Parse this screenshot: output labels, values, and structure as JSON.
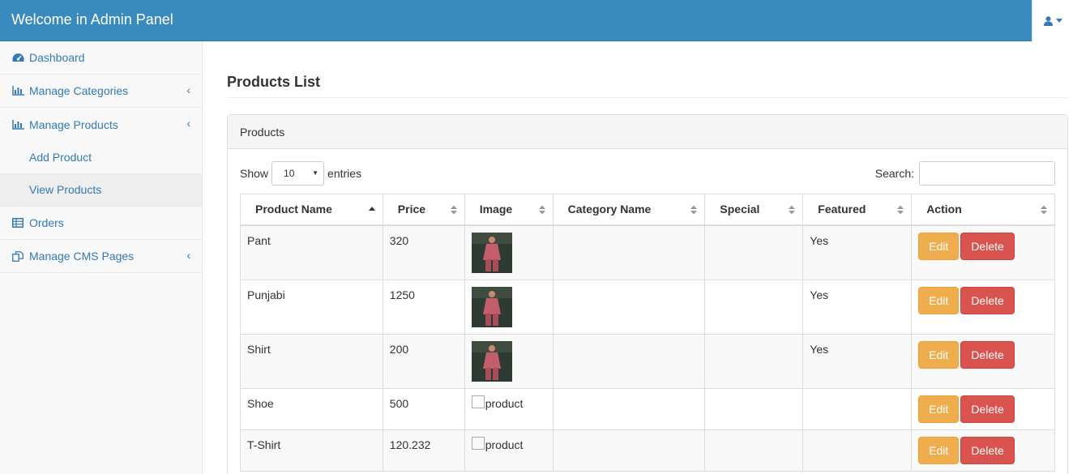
{
  "navbar": {
    "brand": "Welcome in Admin Panel",
    "user_icon": "user-icon",
    "caret_icon": "caret-down-icon"
  },
  "sidebar": {
    "items": [
      {
        "label": "Dashboard",
        "icon": "dashboard-icon"
      },
      {
        "label": "Manage Categories",
        "icon": "bar-chart-icon",
        "chevron": "‹"
      },
      {
        "label": "Manage Products",
        "icon": "bar-chart-icon",
        "chevron": "‹"
      },
      {
        "label": "Orders",
        "icon": "table-icon"
      },
      {
        "label": "Manage CMS Pages",
        "icon": "files-icon",
        "chevron": "‹"
      }
    ],
    "subitems": [
      {
        "label": "Add Product"
      },
      {
        "label": "View Products",
        "active": true
      }
    ]
  },
  "main": {
    "title": "Products List",
    "panel_heading": "Products",
    "length": {
      "show": "Show",
      "value": "10",
      "entries": "entries"
    },
    "search": {
      "label": "Search:",
      "value": ""
    }
  },
  "table": {
    "columns": [
      "Product Name",
      "Price",
      "Image",
      "Category Name",
      "Special",
      "Featured",
      "Action"
    ],
    "sorted_column": "Product Name",
    "rows": [
      {
        "name": "Pant",
        "price": "320",
        "image": "photo",
        "category": "",
        "special": "",
        "featured": "Yes",
        "edit": "Edit",
        "delete": "Delete"
      },
      {
        "name": "Punjabi",
        "price": "1250",
        "image": "photo",
        "category": "",
        "special": "",
        "featured": "Yes",
        "edit": "Edit",
        "delete": "Delete"
      },
      {
        "name": "Shirt",
        "price": "200",
        "image": "photo",
        "category": "",
        "special": "",
        "featured": "Yes",
        "edit": "Edit",
        "delete": "Delete"
      },
      {
        "name": "Shoe",
        "price": "500",
        "image": "product",
        "category": "",
        "special": "",
        "featured": "",
        "edit": "Edit",
        "delete": "Delete"
      },
      {
        "name": "T-Shirt",
        "price": "120.232",
        "image": "product",
        "category": "",
        "special": "",
        "featured": "",
        "edit": "Edit",
        "delete": "Delete"
      }
    ]
  },
  "colors": {
    "navbar": "#3a8bbd",
    "link": "#337ab7",
    "edit": "#f0ad4e",
    "delete": "#d9534f"
  }
}
